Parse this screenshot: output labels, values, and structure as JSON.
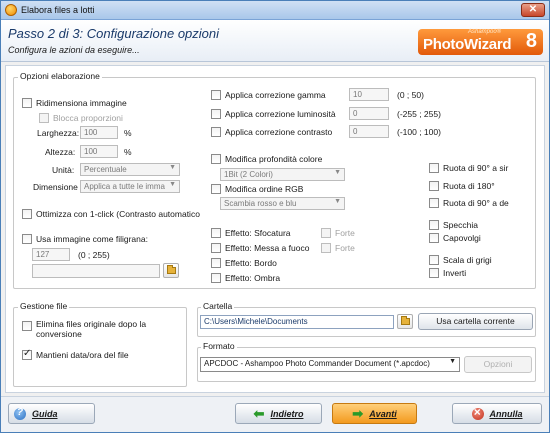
{
  "window": {
    "title": "Elabora files a lotti",
    "close": "✕"
  },
  "header": {
    "step_title": "Passo 2 di 3: Configurazione opzioni",
    "subtitle": "Configura le azioni da eseguire...",
    "logo_brand": "Ashampoo®",
    "logo_name": "PhotoWizard",
    "logo_version": "8"
  },
  "options": {
    "group_label": "Opzioni elaborazione",
    "resize": {
      "label": "Ridimensiona immagine",
      "checked": false,
      "keep_ratio_label": "Blocca proporzioni",
      "width_label": "Larghezza:",
      "width_value": "100",
      "width_unit": "%",
      "height_label": "Altezza:",
      "height_value": "100",
      "height_unit": "%",
      "unit_label": "Unità:",
      "unit_value": "Percentuale",
      "dimension_label": "Dimensione",
      "dimension_value": "Applica a tutte le imma"
    },
    "optimize_label": "Ottimizza con 1-click (Contrasto automatico",
    "watermark": {
      "label": "Usa immagine come filigrana:",
      "value": "127",
      "range": "(0 ; 255)"
    },
    "gamma": {
      "label": "Applica correzione gamma",
      "value": "10",
      "range": "(0 ; 50)"
    },
    "brightness": {
      "label": "Applica correzione luminosità",
      "value": "0",
      "range": "(-255 ; 255)"
    },
    "contrast": {
      "label": "Applica correzione contrasto",
      "value": "0",
      "range": "(-100 ; 100)"
    },
    "depth": {
      "label": "Modifica profondità colore",
      "value": "1Bit (2 Colori)"
    },
    "rgb": {
      "label": "Modifica ordine RGB",
      "value": "Scambia rosso e blu"
    },
    "effects": {
      "blur": "Effetto: Sfocatura",
      "sharpen": "Effetto: Messa a fuoco",
      "border": "Effetto: Bordo",
      "shadow": "Effetto: Ombra",
      "strong1": "Forte",
      "strong2": "Forte"
    },
    "rotate_left": "Ruota di 90° a sir",
    "rotate_180": "Ruota di 180°",
    "rotate_right": "Ruota di 90° a de",
    "mirror": "Specchia",
    "flip": "Capovolgi",
    "grayscale": "Scala di grigi",
    "invert": "Inverti"
  },
  "file_management": {
    "group_label": "Gestione file",
    "delete_original": "Elimina files originale dopo la conversione",
    "keep_date": "Mantieni data/ora del file"
  },
  "folder": {
    "label": "Cartella",
    "path": "C:\\Users\\Michele\\Documents",
    "use_current": "Usa cartella corrente"
  },
  "format": {
    "label": "Formato",
    "value": "APCDOC - Ashampoo Photo Commander Document (*.apcdoc)",
    "options_btn": "Opzioni"
  },
  "footer": {
    "help": "Guida",
    "back": "Indietro",
    "next": "Avanti",
    "cancel": "Annulla"
  }
}
